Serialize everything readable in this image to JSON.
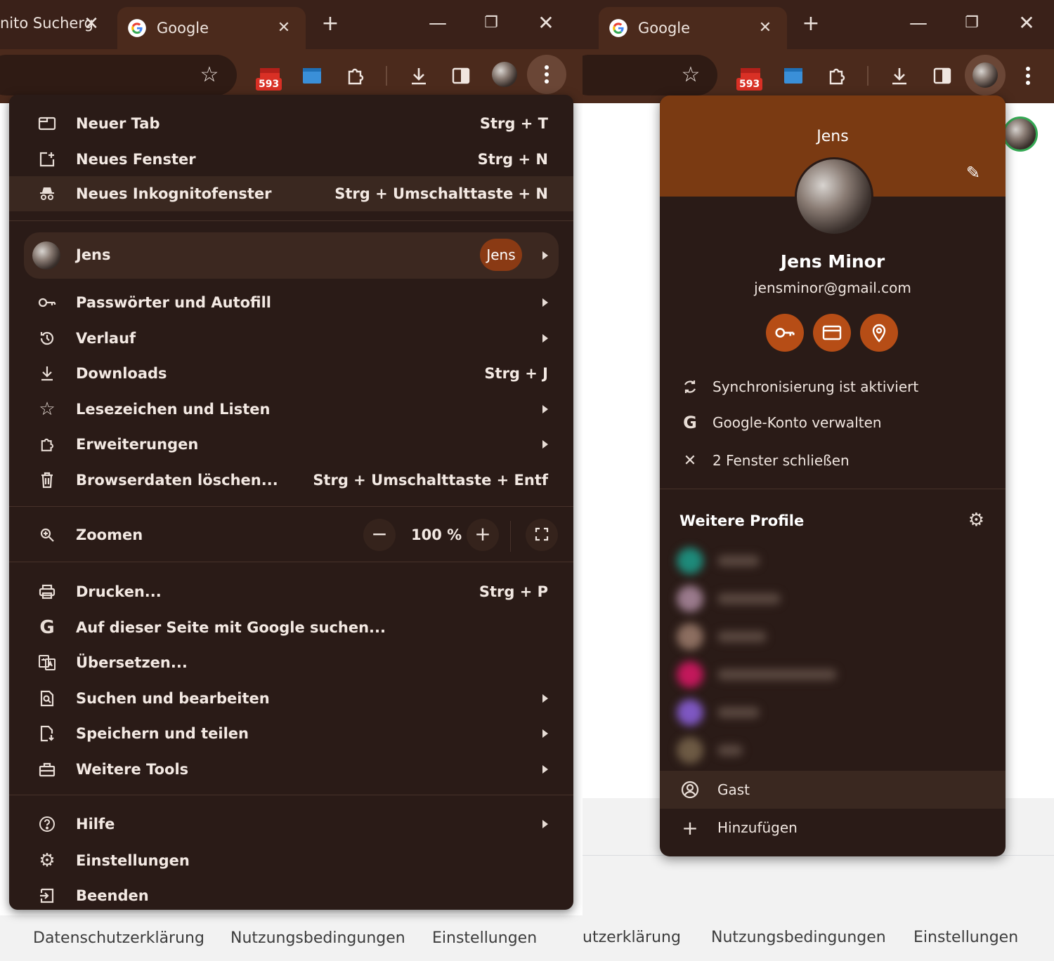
{
  "left_window": {
    "tabs": [
      {
        "title": "nito Sucherg",
        "active": false
      },
      {
        "title": "Google",
        "active": true
      }
    ],
    "extension_badge": "593",
    "menu": {
      "items_top": [
        {
          "label": "Neuer Tab",
          "shortcut": "Strg + T",
          "icon": "new-tab-icon"
        },
        {
          "label": "Neues Fenster",
          "shortcut": "Strg + N",
          "icon": "new-window-icon"
        },
        {
          "label": "Neues Inkognitofenster",
          "shortcut": "Strg + Umschalttaste + N",
          "icon": "incognito-icon"
        }
      ],
      "profile": {
        "name": "Jens",
        "pill": "Jens"
      },
      "items_mid": [
        {
          "label": "Passwörter und Autofill",
          "shortcut": "",
          "icon": "key-icon",
          "submenu": true
        },
        {
          "label": "Verlauf",
          "shortcut": "",
          "icon": "history-icon",
          "submenu": true
        },
        {
          "label": "Downloads",
          "shortcut": "Strg + J",
          "icon": "download-icon",
          "submenu": false
        },
        {
          "label": "Lesezeichen und Listen",
          "shortcut": "",
          "icon": "star-icon",
          "submenu": true
        },
        {
          "label": "Erweiterungen",
          "shortcut": "",
          "icon": "puzzle-icon",
          "submenu": true
        },
        {
          "label": "Browserdaten löschen...",
          "shortcut": "Strg + Umschalttaste + Entf",
          "icon": "trash-icon",
          "submenu": false
        }
      ],
      "zoom": {
        "label": "Zoomen",
        "value": "100 %",
        "minus": "−",
        "plus": "+"
      },
      "items_tools": [
        {
          "label": "Drucken...",
          "shortcut": "Strg + P",
          "icon": "print-icon",
          "submenu": false
        },
        {
          "label": "Auf dieser Seite mit Google suchen...",
          "shortcut": "",
          "icon": "google-g-icon",
          "submenu": false
        },
        {
          "label": "Übersetzen...",
          "shortcut": "",
          "icon": "translate-icon",
          "submenu": false
        },
        {
          "label": "Suchen und bearbeiten",
          "shortcut": "",
          "icon": "find-icon",
          "submenu": true
        },
        {
          "label": "Speichern und teilen",
          "shortcut": "",
          "icon": "save-share-icon",
          "submenu": true
        },
        {
          "label": "Weitere Tools",
          "shortcut": "",
          "icon": "toolbox-icon",
          "submenu": true
        }
      ],
      "items_bottom": [
        {
          "label": "Hilfe",
          "icon": "help-icon",
          "submenu": true
        },
        {
          "label": "Einstellungen",
          "icon": "settings-gear-icon",
          "submenu": false
        },
        {
          "label": "Beenden",
          "icon": "exit-icon",
          "submenu": false
        }
      ]
    },
    "footer": [
      "Datenschutzerklärung",
      "Nutzungsbedingungen",
      "Einstellungen"
    ]
  },
  "right_window": {
    "tab_title": "Google",
    "extension_badge": "593",
    "profile_panel": {
      "header_name": "Jens",
      "full_name": "Jens Minor",
      "email": "jensminor@gmail.com",
      "actions": [
        {
          "label": "Synchronisierung ist aktiviert",
          "icon": "sync-icon"
        },
        {
          "label": "Google-Konto verwalten",
          "icon": "google-g-icon"
        },
        {
          "label": "2 Fenster schließen",
          "icon": "close-icon"
        }
      ],
      "other_profiles_title": "Weitere Profile",
      "guest_label": "Gast",
      "add_label": "Hinzufügen"
    },
    "footer": [
      "utzerklärung",
      "Nutzungsbedingungen",
      "Einstellungen"
    ]
  },
  "colors": {
    "frame": "#3a2119",
    "toolbar": "#4b2a1c",
    "menu_bg": "#2a1b17",
    "accent": "#b64d16",
    "panel_header": "#7a3a12",
    "badge_red": "#d93025"
  }
}
